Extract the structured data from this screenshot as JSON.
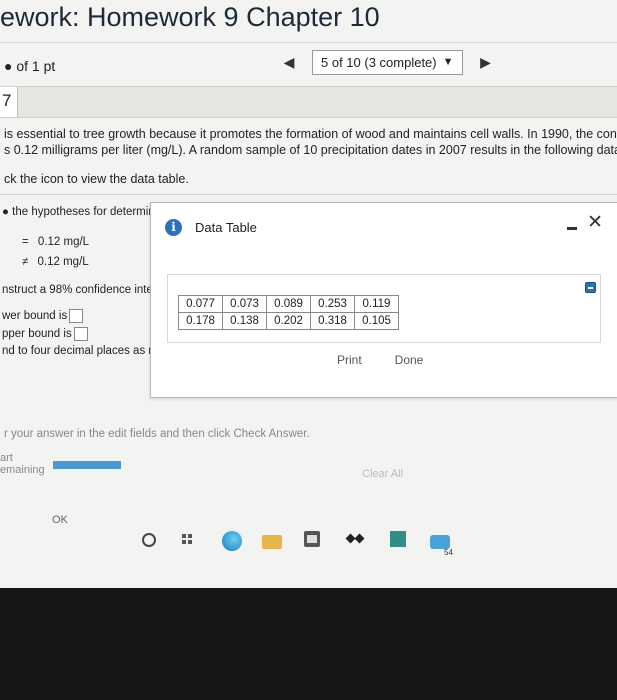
{
  "header": {
    "title": "ework: Homework 9 Chapter 10",
    "points": "of 1 pt",
    "progress": "5 of 10 (3 complete)"
  },
  "question": {
    "number": "7",
    "stem_line1": "is essential to tree growth because it promotes the formation of wood and maintains cell walls. In 1990, the concentratio",
    "stem_line2": "s 0.12 milligrams per liter (mg/L). A random sample of 10 precipitation dates in 2007 results in the following data table. C",
    "instruction": "ck the icon to view the data table."
  },
  "left_panel": {
    "hypotheses_label": "the hypotheses for determir",
    "h0_symbol": "=",
    "h0_value": "0.12 mg/L",
    "h1_symbol": "≠",
    "h1_value": "0.12 mg/L",
    "ci_label": "nstruct a 98% confidence inter",
    "lower_label": "wer bound is",
    "upper_label": "pper bound is",
    "rounding_note": "nd to four decimal places as nee"
  },
  "dialog": {
    "title": "Data Table",
    "table_rows": [
      [
        "0.077",
        "0.073",
        "0.089",
        "0.253",
        "0.119"
      ],
      [
        "0.178",
        "0.138",
        "0.202",
        "0.318",
        "0.105"
      ]
    ],
    "print_label": "Print",
    "done_label": "Done"
  },
  "footer": {
    "instruction": "r your answer in the edit fields and then click Check Answer.",
    "part_label": "art",
    "remaining_label": "emaining",
    "clear_label": "Clear All",
    "ok_label": "OK"
  },
  "taskbar": {
    "badge": "54"
  },
  "colors": {
    "accent": "#2c6fbd",
    "progress_bar": "#4a98d6"
  }
}
